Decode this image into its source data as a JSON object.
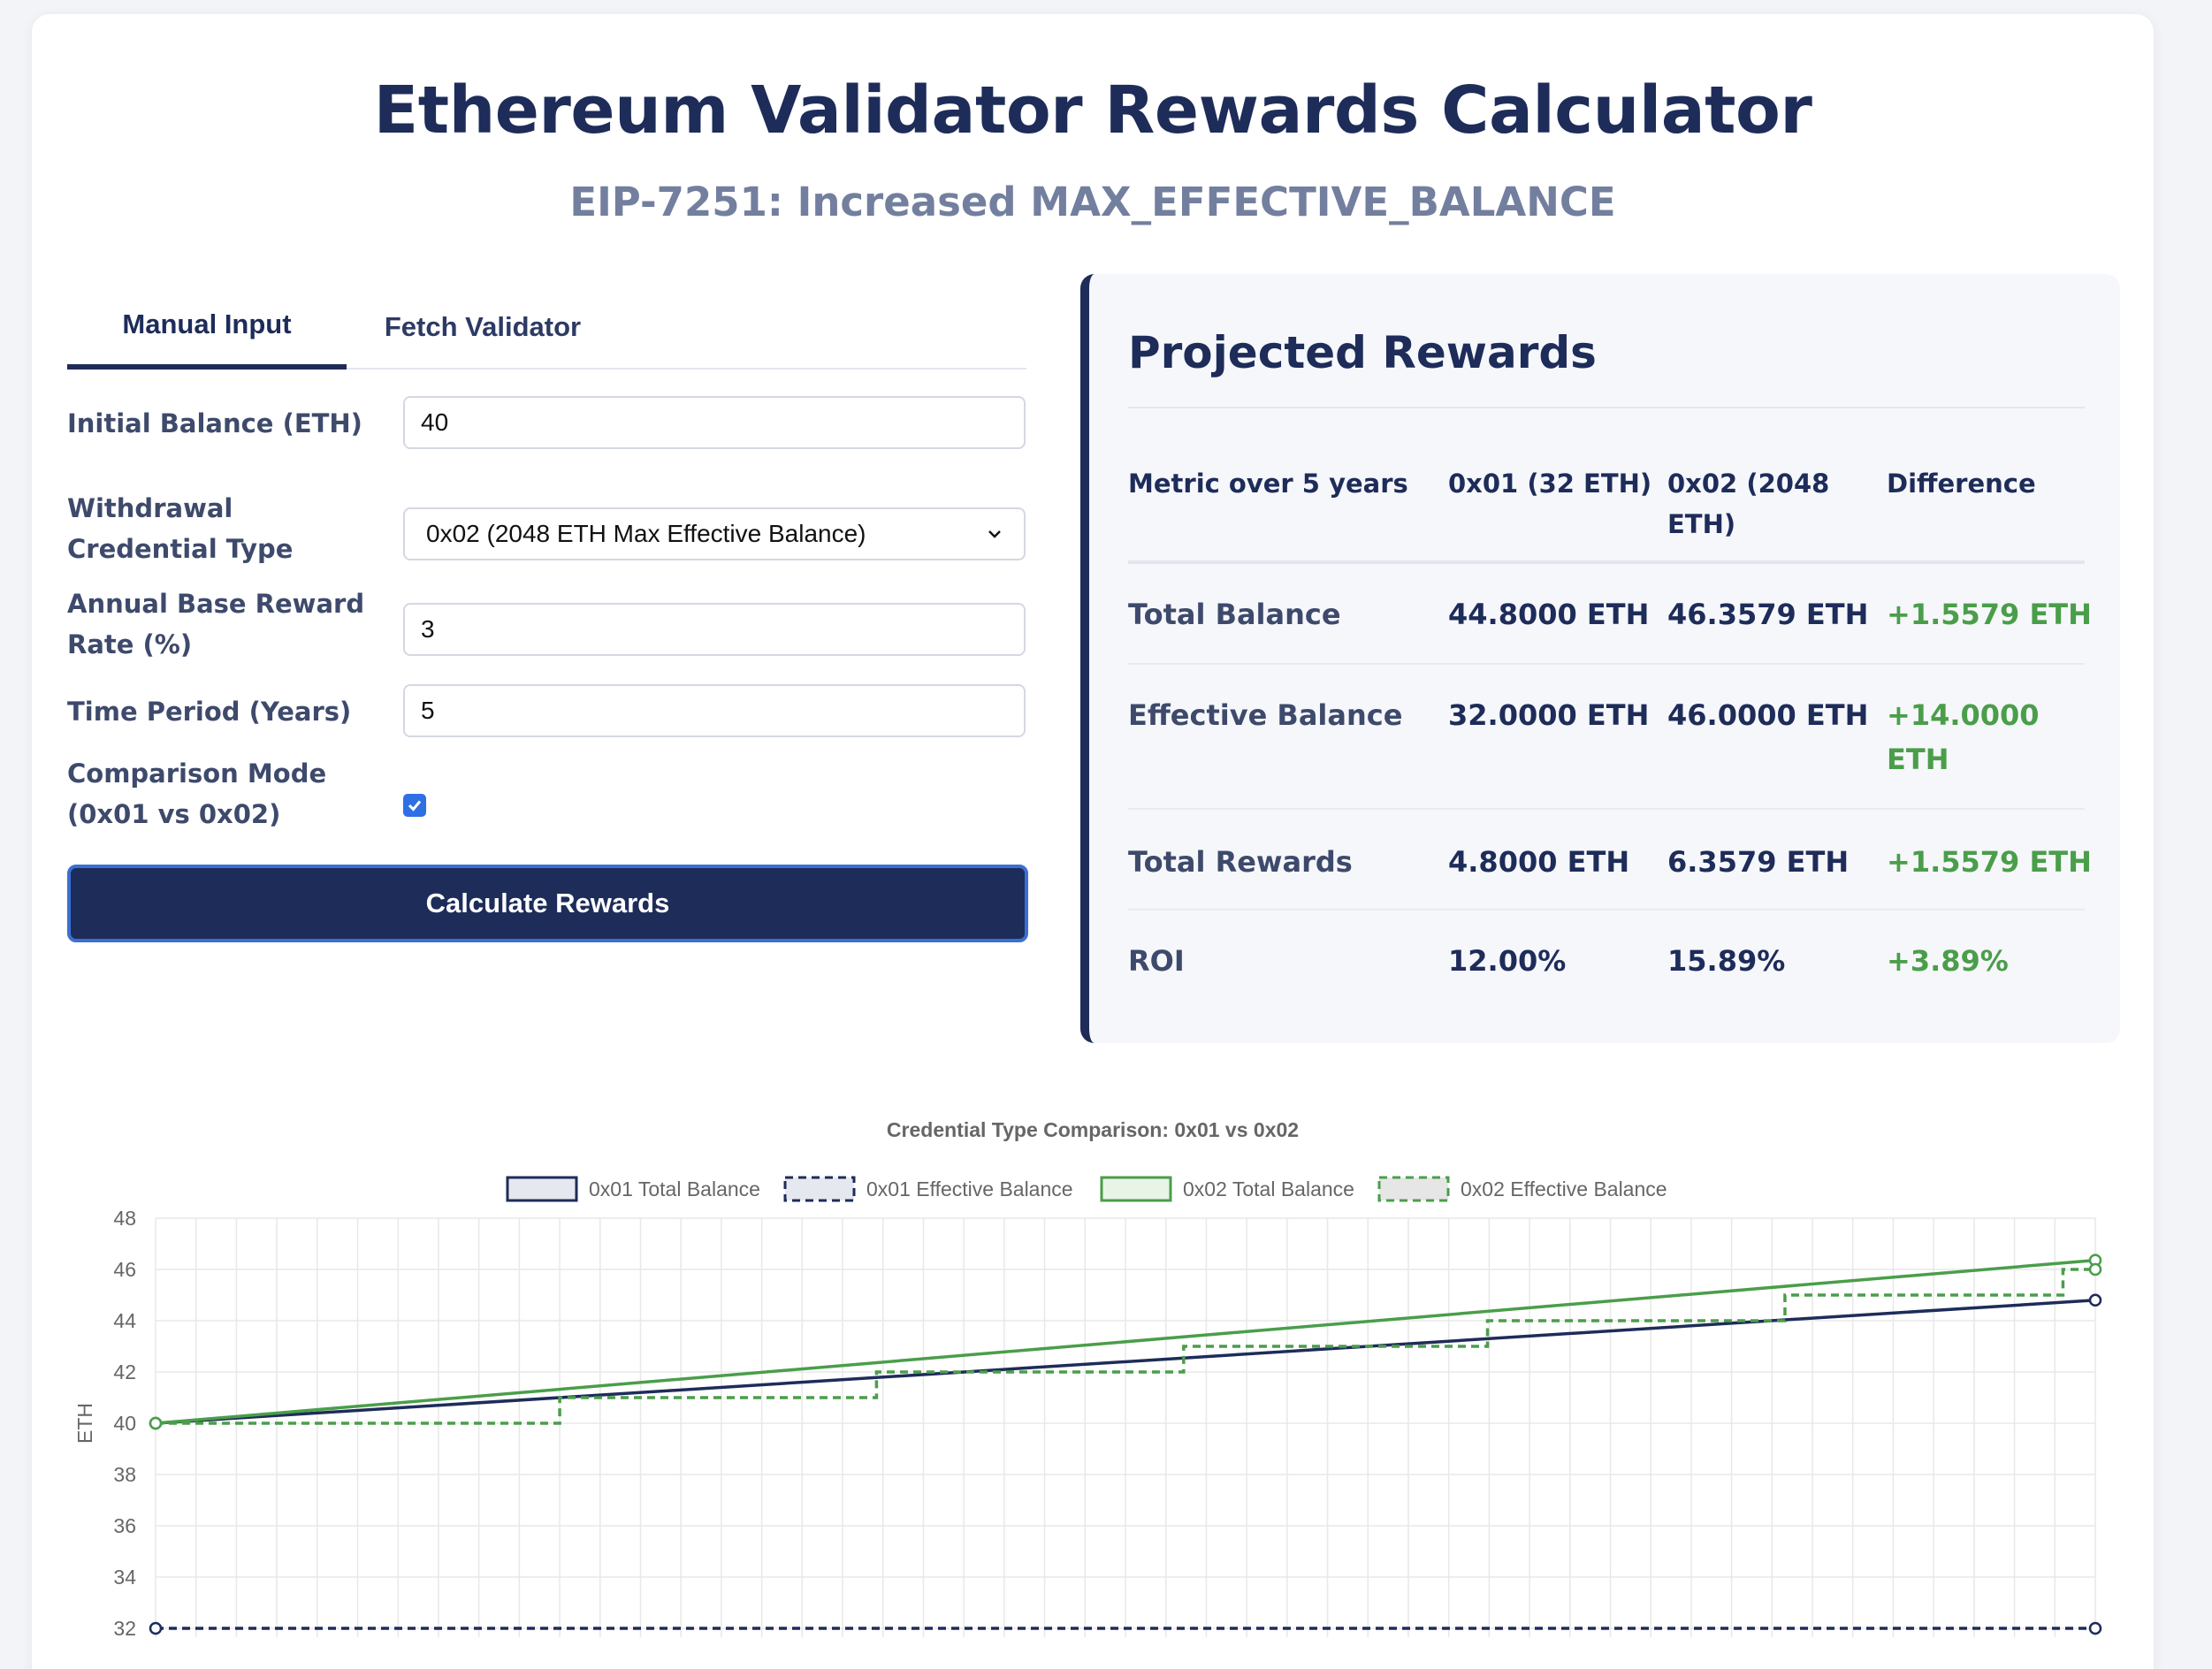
{
  "header": {
    "title": "Ethereum Validator Rewards Calculator",
    "subtitle": "EIP-7251: Increased MAX_EFFECTIVE_BALANCE"
  },
  "tabs": [
    {
      "label": "Manual Input",
      "active": true
    },
    {
      "label": "Fetch Validator",
      "active": false
    }
  ],
  "form": {
    "initial_balance_label": "Initial Balance (ETH)",
    "initial_balance_value": "40",
    "credential_label": "Withdrawal Credential Type",
    "credential_value": "0x02 (2048 ETH Max Effective Balance)",
    "reward_rate_label": "Annual Base Reward Rate (%)",
    "reward_rate_value": "3",
    "period_label": "Time Period (Years)",
    "period_value": "5",
    "comparison_label": "Comparison Mode (0x01 vs 0x02)",
    "comparison_checked": true,
    "button_label": "Calculate Rewards"
  },
  "results": {
    "title": "Projected Rewards",
    "headers": [
      "Metric over 5 years",
      "0x01 (32 ETH)",
      "0x02 (2048 ETH)",
      "Difference"
    ],
    "rows": [
      {
        "metric": "Total Balance",
        "v1": "44.8000 ETH",
        "v2": "46.3579 ETH",
        "diff": "+1.5579 ETH"
      },
      {
        "metric": "Effective Balance",
        "v1": "32.0000 ETH",
        "v2": "46.0000 ETH",
        "diff": "+14.0000 ETH"
      },
      {
        "metric": "Total Rewards",
        "v1": "4.8000 ETH",
        "v2": "6.3579 ETH",
        "diff": "+1.5579 ETH"
      },
      {
        "metric": "ROI",
        "v1": "12.00%",
        "v2": "15.89%",
        "diff": "+3.89%"
      }
    ]
  },
  "colors": {
    "navy": "#1e2c5a",
    "green": "#4a9e4a",
    "grid": "#e8e8e8"
  },
  "chart_data": {
    "type": "line",
    "title": "Credential Type Comparison: 0x01 vs 0x02",
    "ylabel": "ETH",
    "ylim": [
      32,
      48
    ],
    "yticks": [
      32,
      34,
      36,
      38,
      40,
      42,
      44,
      46,
      48
    ],
    "xlim": [
      0,
      60
    ],
    "grid": true,
    "legend_position": "top",
    "series": [
      {
        "name": "0x01 Total Balance",
        "style": "solid",
        "color": "#1e2c5a",
        "x": [
          0,
          60
        ],
        "y": [
          40.0,
          44.8
        ]
      },
      {
        "name": "0x01 Effective Balance",
        "style": "dashed",
        "color": "#1e2c5a",
        "x": [
          0,
          60
        ],
        "y": [
          32.0,
          32.0
        ]
      },
      {
        "name": "0x02 Total Balance",
        "style": "solid",
        "color": "#4a9e4a",
        "x": [
          0,
          60
        ],
        "y": [
          40.0,
          46.3579
        ]
      },
      {
        "name": "0x02 Effective Balance",
        "style": "dashed-step",
        "color": "#4a9e4a",
        "x": [
          0,
          12.5,
          22.3,
          31.8,
          41.2,
          50.4,
          59.0,
          60
        ],
        "y": [
          40,
          41,
          42,
          43,
          44,
          45,
          46,
          46
        ]
      }
    ]
  }
}
